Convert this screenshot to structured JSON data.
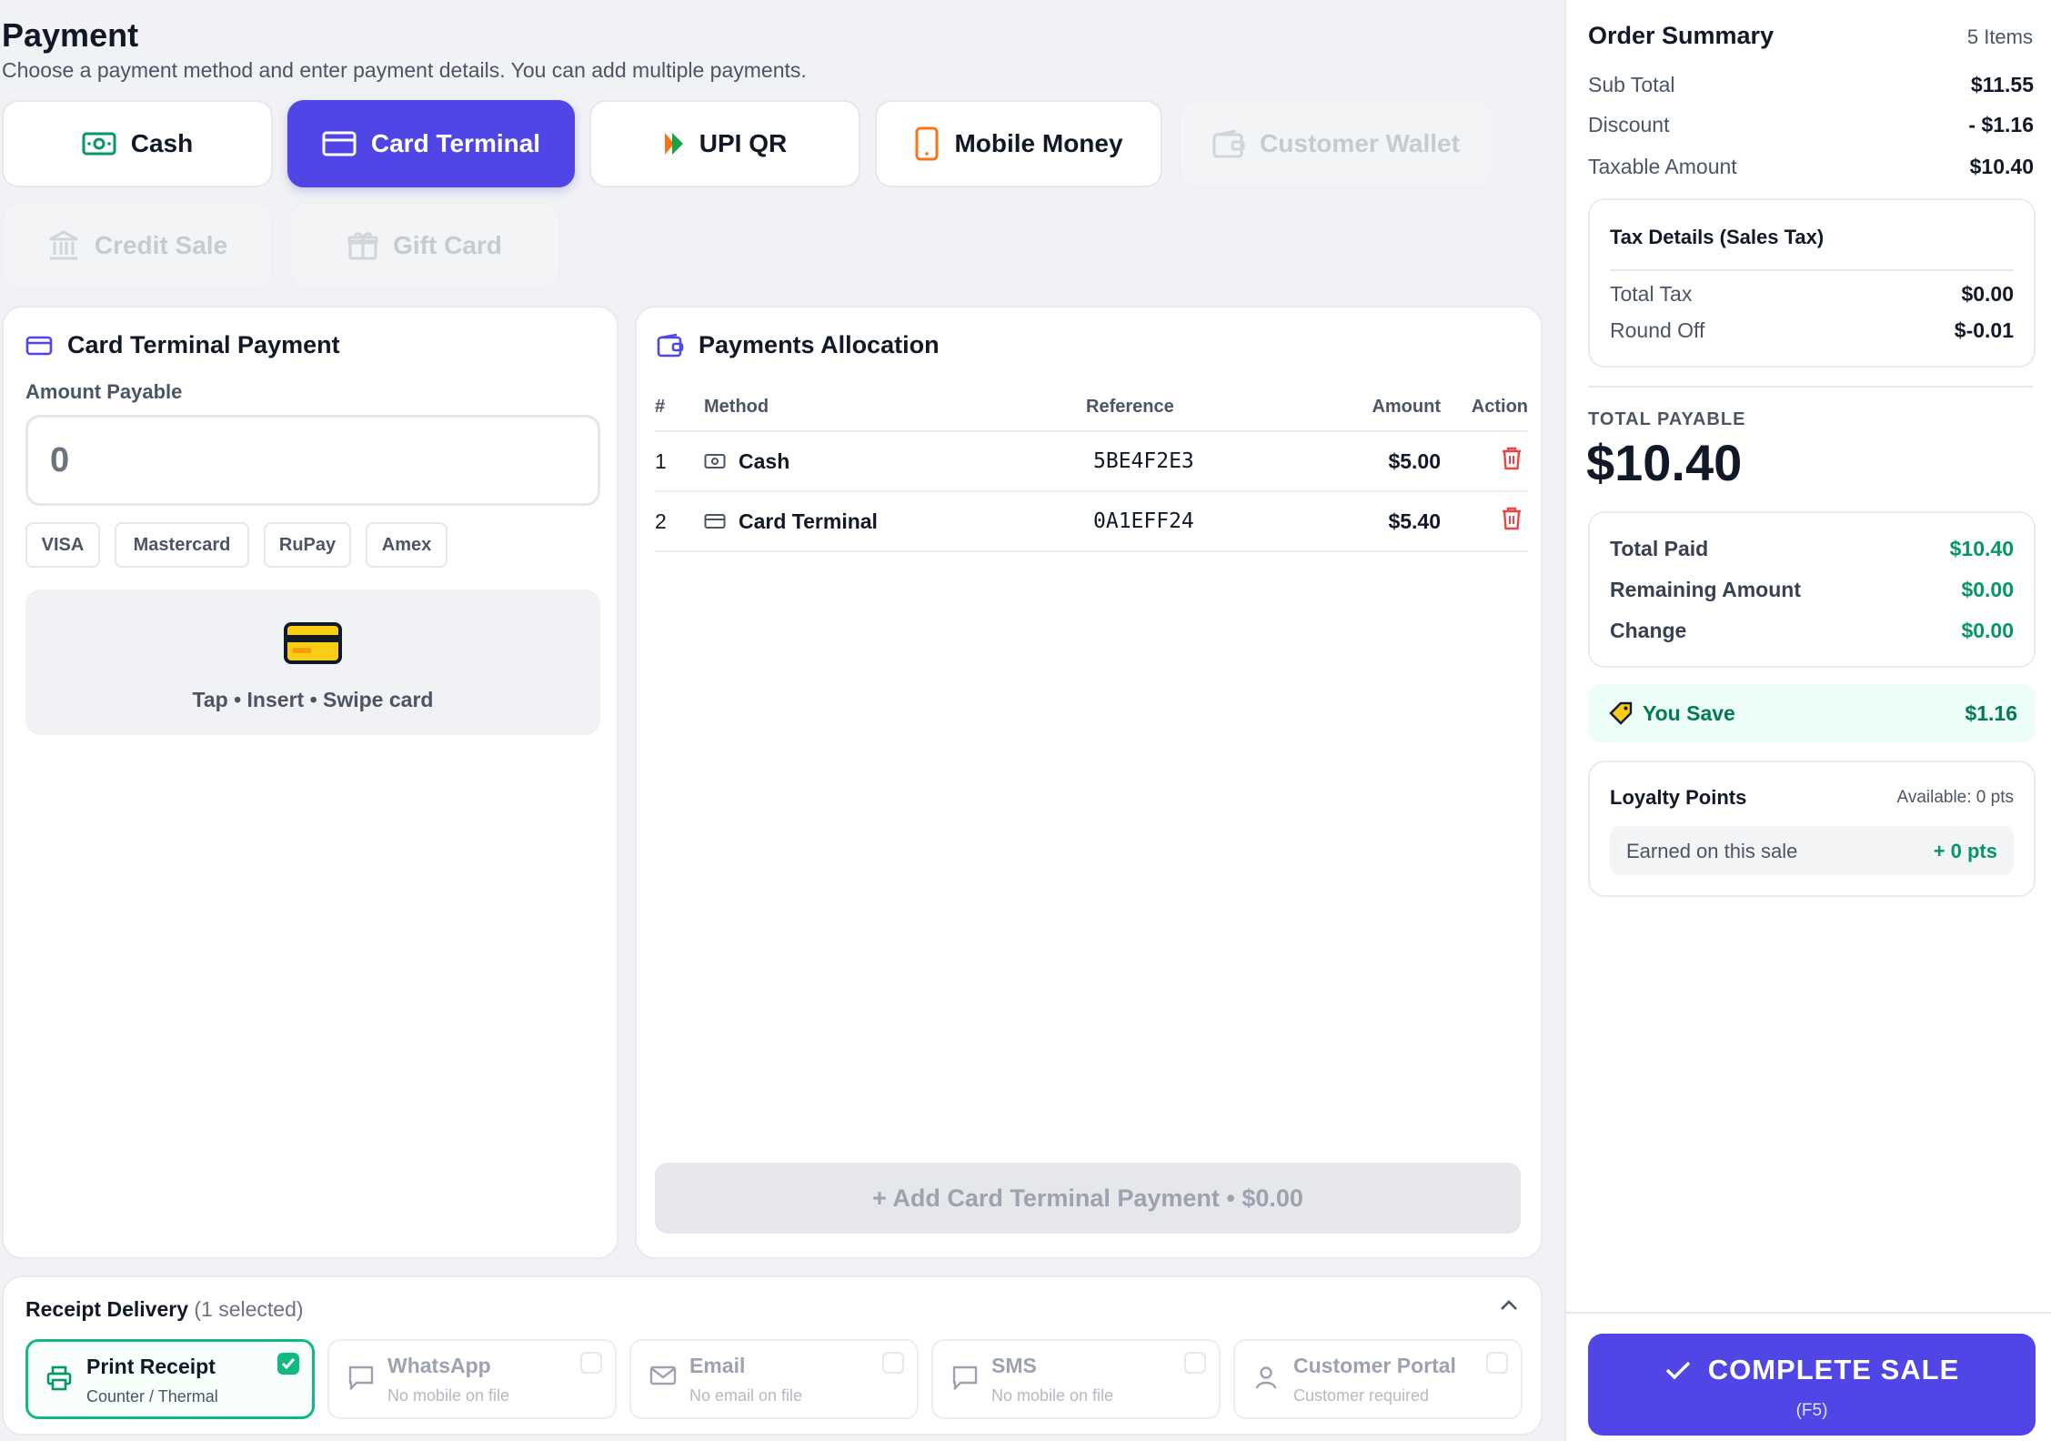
{
  "header": {
    "title": "Payment",
    "subtitle": "Choose a payment method and enter payment details. You can add multiple payments."
  },
  "methods": [
    {
      "label": "Cash",
      "icon": "cash-icon",
      "state": "normal"
    },
    {
      "label": "Card Terminal",
      "icon": "card-icon",
      "state": "active"
    },
    {
      "label": "UPI QR",
      "icon": "upi-icon",
      "state": "normal"
    },
    {
      "label": "Mobile Money",
      "icon": "mobile-icon",
      "state": "normal"
    },
    {
      "label": "Customer Wallet",
      "icon": "wallet-icon",
      "state": "disabled"
    },
    {
      "label": "Credit Sale",
      "icon": "bank-icon",
      "state": "disabled"
    },
    {
      "label": "Gift Card",
      "icon": "gift-icon",
      "state": "disabled"
    }
  ],
  "card_terminal": {
    "title": "Card Terminal Payment",
    "amount_label": "Amount Payable",
    "amount_value": "0",
    "networks": [
      "VISA",
      "Mastercard",
      "RuPay",
      "Amex"
    ],
    "tap_text": "Tap • Insert • Swipe card"
  },
  "allocation": {
    "title": "Payments Allocation",
    "columns": {
      "num": "#",
      "method": "Method",
      "reference": "Reference",
      "amount": "Amount",
      "action": "Action"
    },
    "rows": [
      {
        "num": "1",
        "method": "Cash",
        "reference": "5BE4F2E3",
        "amount": "$5.00"
      },
      {
        "num": "2",
        "method": "Card Terminal",
        "reference": "0A1EFF24",
        "amount": "$5.40"
      }
    ],
    "add_button": "+ Add Card Terminal Payment • $0.00"
  },
  "receipt": {
    "title": "Receipt Delivery",
    "count": "(1 selected)",
    "options": [
      {
        "title": "Print Receipt",
        "sub": "Counter / Thermal",
        "selected": true
      },
      {
        "title": "WhatsApp",
        "sub": "No mobile on file",
        "selected": false
      },
      {
        "title": "Email",
        "sub": "No email on file",
        "selected": false
      },
      {
        "title": "SMS",
        "sub": "No mobile on file",
        "selected": false
      },
      {
        "title": "Customer Portal",
        "sub": "Customer required",
        "selected": false
      }
    ]
  },
  "summary": {
    "title": "Order Summary",
    "items": "5 Items",
    "sub_total_label": "Sub Total",
    "sub_total": "$11.55",
    "discount_label": "Discount",
    "discount": "- $1.16",
    "taxable_label": "Taxable Amount",
    "taxable": "$10.40",
    "tax_title": "Tax Details (Sales Tax)",
    "total_tax_label": "Total Tax",
    "total_tax": "$0.00",
    "round_off_label": "Round Off",
    "round_off": "$-0.01",
    "total_payable_label": "TOTAL PAYABLE",
    "total_payable": "$10.40",
    "total_paid_label": "Total Paid",
    "total_paid": "$10.40",
    "remaining_label": "Remaining Amount",
    "remaining": "$0.00",
    "change_label": "Change",
    "change": "$0.00",
    "save_label": "You Save",
    "save": "$1.16",
    "loyalty_title": "Loyalty Points",
    "loyalty_available": "Available: 0 pts",
    "loyalty_earned_label": "Earned on this sale",
    "loyalty_earned": "+ 0 pts",
    "complete_label": "COMPLETE SALE",
    "complete_shortcut": "(F5)"
  }
}
